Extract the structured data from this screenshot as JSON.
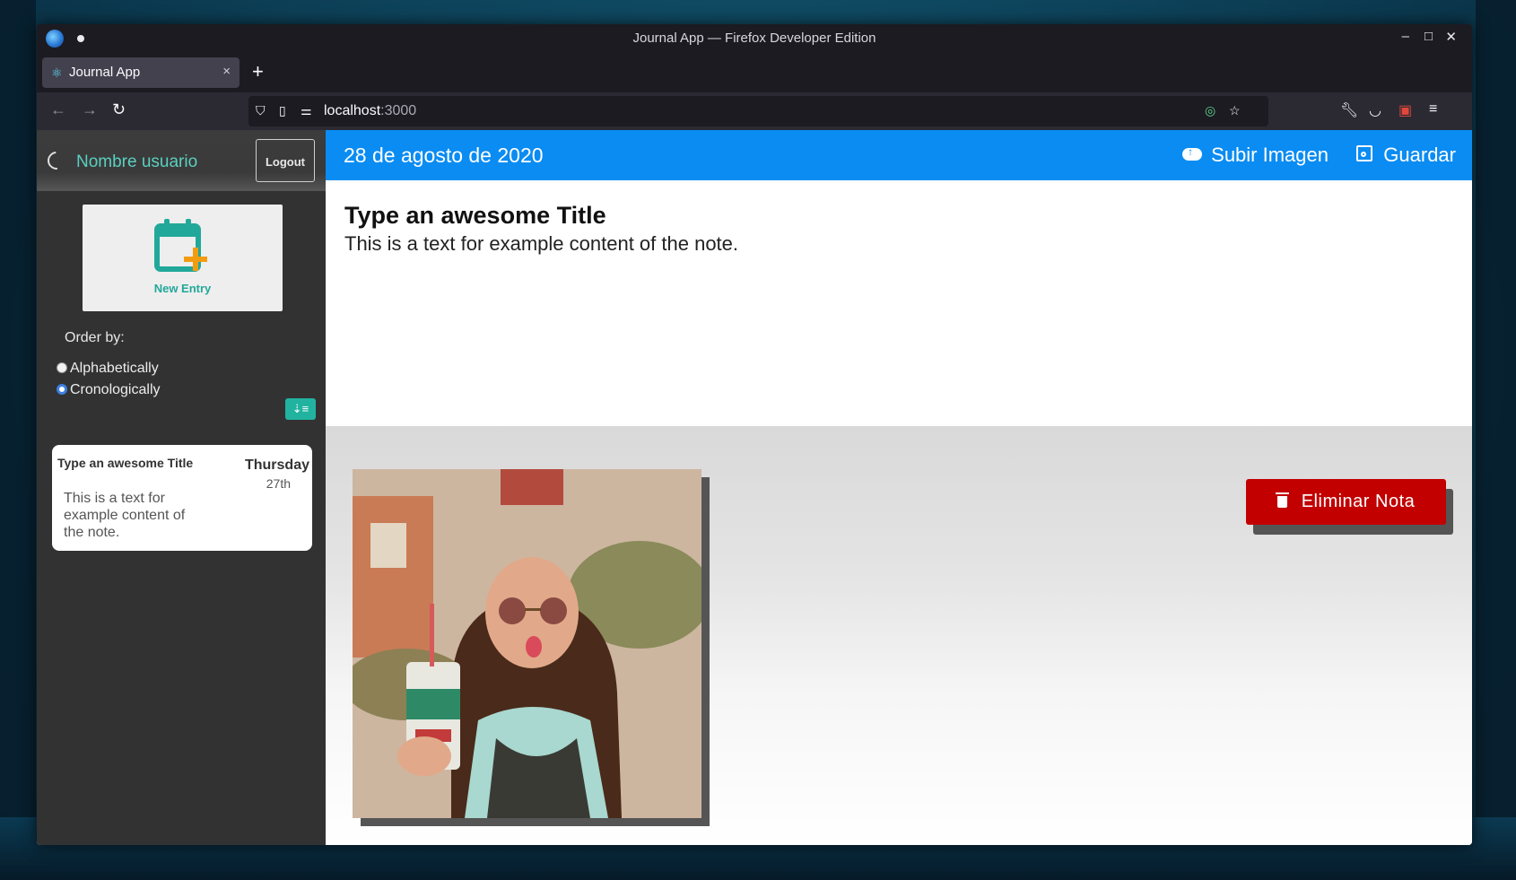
{
  "window": {
    "title": "Journal App — Firefox Developer Edition"
  },
  "tab": {
    "label": "Journal App",
    "close": "×",
    "new_tab": "+"
  },
  "address_bar": {
    "host": "localhost",
    "port": ":3000"
  },
  "sidebar": {
    "username": "Nombre usuario",
    "logout_label": "Logout",
    "new_entry_label": "New Entry",
    "order_by_label": "Order by:",
    "order_options": [
      {
        "label": "Alphabetically",
        "selected": false
      },
      {
        "label": "Cronologically",
        "selected": true
      }
    ],
    "entries": [
      {
        "title": "Type an awesome Title",
        "body": "This is a text for example content of the note.",
        "day_name": "Thursday",
        "day": "27th"
      }
    ]
  },
  "note": {
    "date": "28 de agosto de 2020",
    "upload_label": "Subir Imagen",
    "save_label": "Guardar",
    "title": "Type an awesome Title",
    "body": "This is a text for example content of the note.",
    "delete_label": "Eliminar Nota"
  },
  "colors": {
    "appbar": "#0a8cf2",
    "accent_teal": "#21b3a0",
    "delete": "#c20000",
    "sidebar_bg": "#323232"
  }
}
